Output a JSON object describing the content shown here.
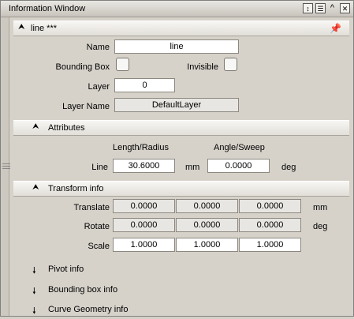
{
  "window": {
    "title": "Information Window"
  },
  "object": {
    "header": "line ***",
    "name_label": "Name",
    "name_value": "line",
    "bounding_box_label": "Bounding Box",
    "invisible_label": "Invisible",
    "layer_label": "Layer",
    "layer_value": "0",
    "layer_name_label": "Layer Name",
    "layer_name_value": "DefaultLayer"
  },
  "attributes": {
    "header": "Attributes",
    "col1_header": "Length/Radius",
    "col2_header": "Angle/Sweep",
    "row_label": "Line",
    "length_value": "30.6000",
    "length_unit": "mm",
    "angle_value": "0.0000",
    "angle_unit": "deg"
  },
  "transform": {
    "header": "Transform info",
    "rows": [
      {
        "label": "Translate",
        "values": [
          "0.0000",
          "0.0000",
          "0.0000"
        ],
        "unit": "mm"
      },
      {
        "label": "Rotate",
        "values": [
          "0.0000",
          "0.0000",
          "0.0000"
        ],
        "unit": "deg"
      },
      {
        "label": "Scale",
        "values": [
          "1.0000",
          "1.0000",
          "1.0000"
        ],
        "unit": ""
      }
    ]
  },
  "collapsed_sections": [
    "Pivot info",
    "Bounding box info",
    "Curve Geometry info"
  ],
  "icons": {
    "collapse": "collapse-arrow-icon",
    "expand": "expand-arrow-icon",
    "pin": "pin-icon"
  }
}
